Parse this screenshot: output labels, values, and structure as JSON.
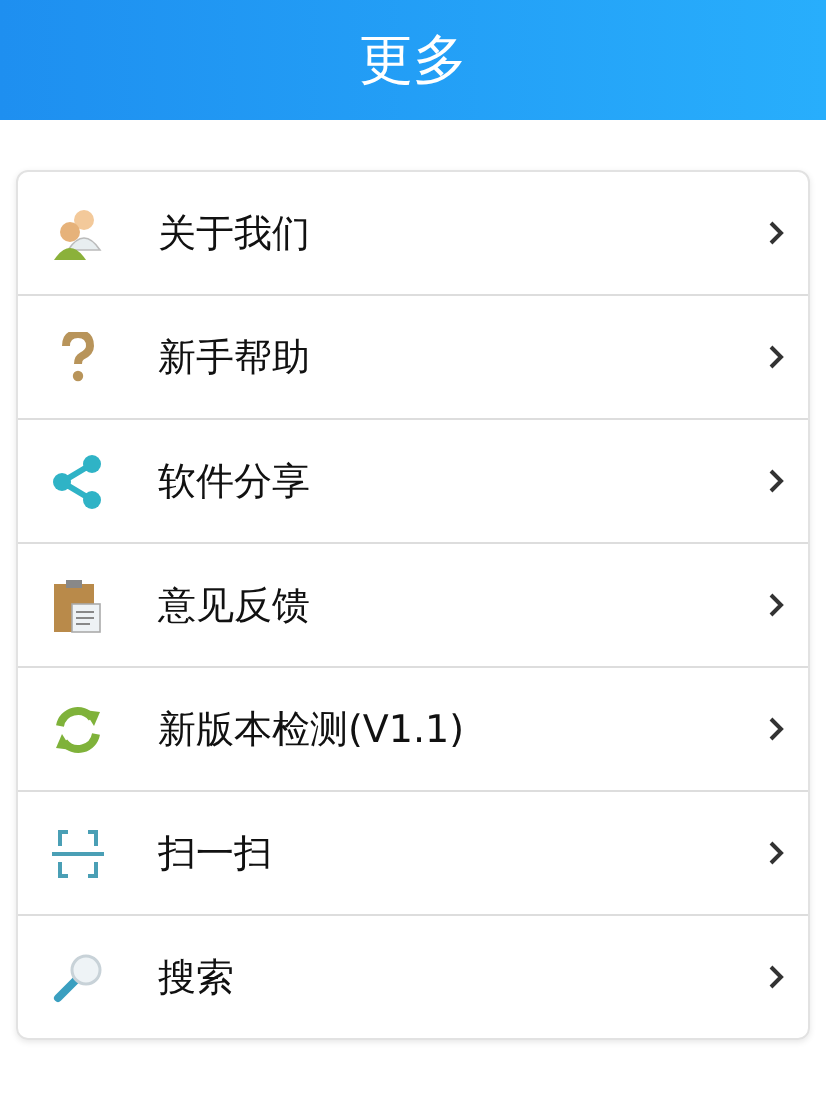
{
  "header": {
    "title": "更多"
  },
  "items": [
    {
      "kind": "people",
      "label": "关于我们"
    },
    {
      "kind": "question",
      "label": "新手帮助"
    },
    {
      "kind": "share",
      "label": "软件分享"
    },
    {
      "kind": "clipboard",
      "label": "意见反馈"
    },
    {
      "kind": "refresh",
      "label": "新版本检测(V1.1)"
    },
    {
      "kind": "scan",
      "label": "扫一扫"
    },
    {
      "kind": "search",
      "label": "搜索"
    }
  ]
}
